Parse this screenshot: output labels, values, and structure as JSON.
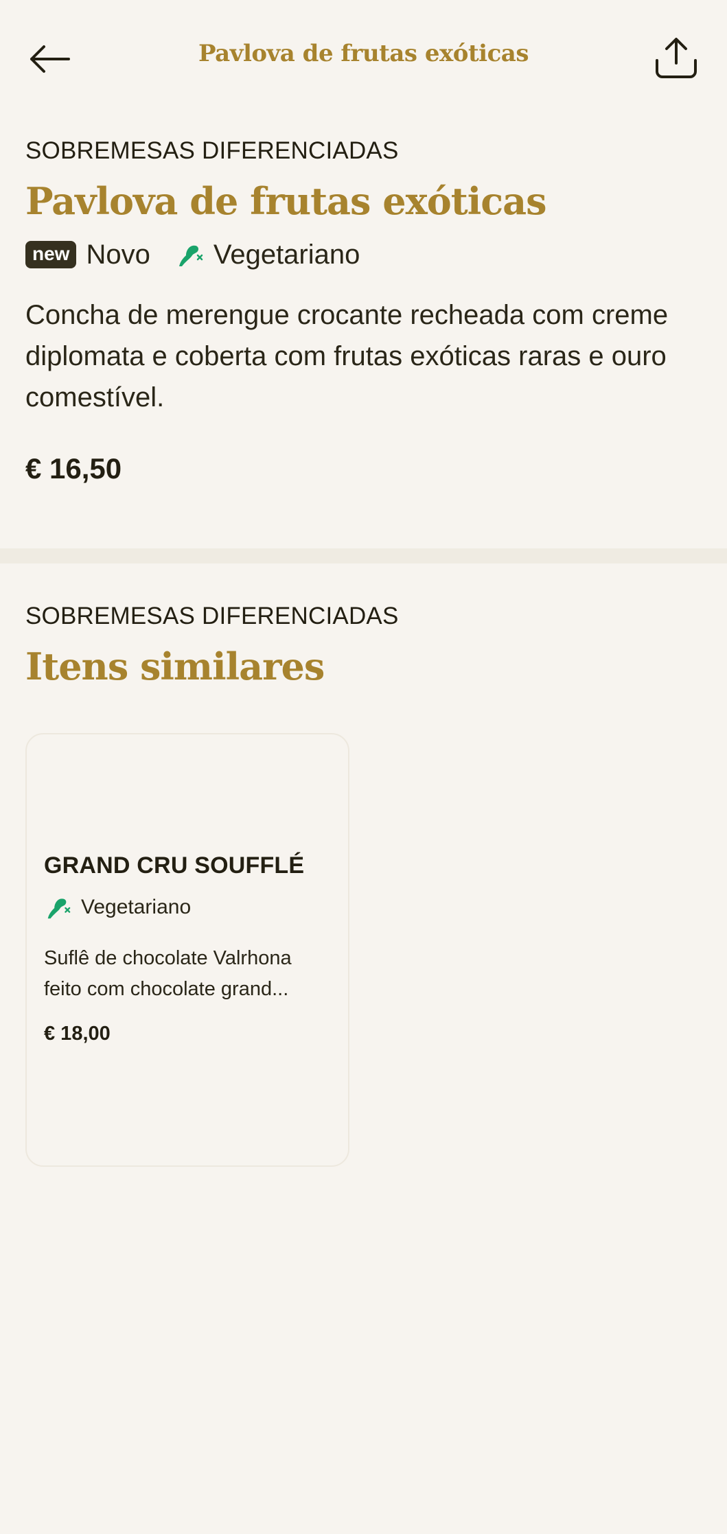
{
  "topbar": {
    "title": "Pavlova de frutas exóticas",
    "back_icon": "arrow-left-icon",
    "share_icon": "share-icon"
  },
  "item": {
    "category": "SOBREMESAS DIFERENCIADAS",
    "title": "Pavlova de frutas exóticas",
    "new_pill": "new",
    "new_label": "Novo",
    "veg_label": "Vegetariano",
    "description": "Concha de merengue crocante recheada com creme diplomata e coberta com frutas exóticas raras e ouro comestível.",
    "price": "€ 16,50"
  },
  "similar": {
    "category": "SOBREMESAS DIFERENCIADAS",
    "title": "Itens similares",
    "cards": [
      {
        "name": "GRAND CRU SOUFFLÉ",
        "veg_label": "Vegetariano",
        "description": "Suflê de chocolate Valrhona feito com chocolate grand...",
        "price": "€ 18,00"
      }
    ]
  },
  "colors": {
    "background": "#f7f4ef",
    "accent_gold": "#a7832e",
    "veg_green": "#1aa36a",
    "text_dark": "#231f12",
    "pill_dark": "#35301f"
  }
}
